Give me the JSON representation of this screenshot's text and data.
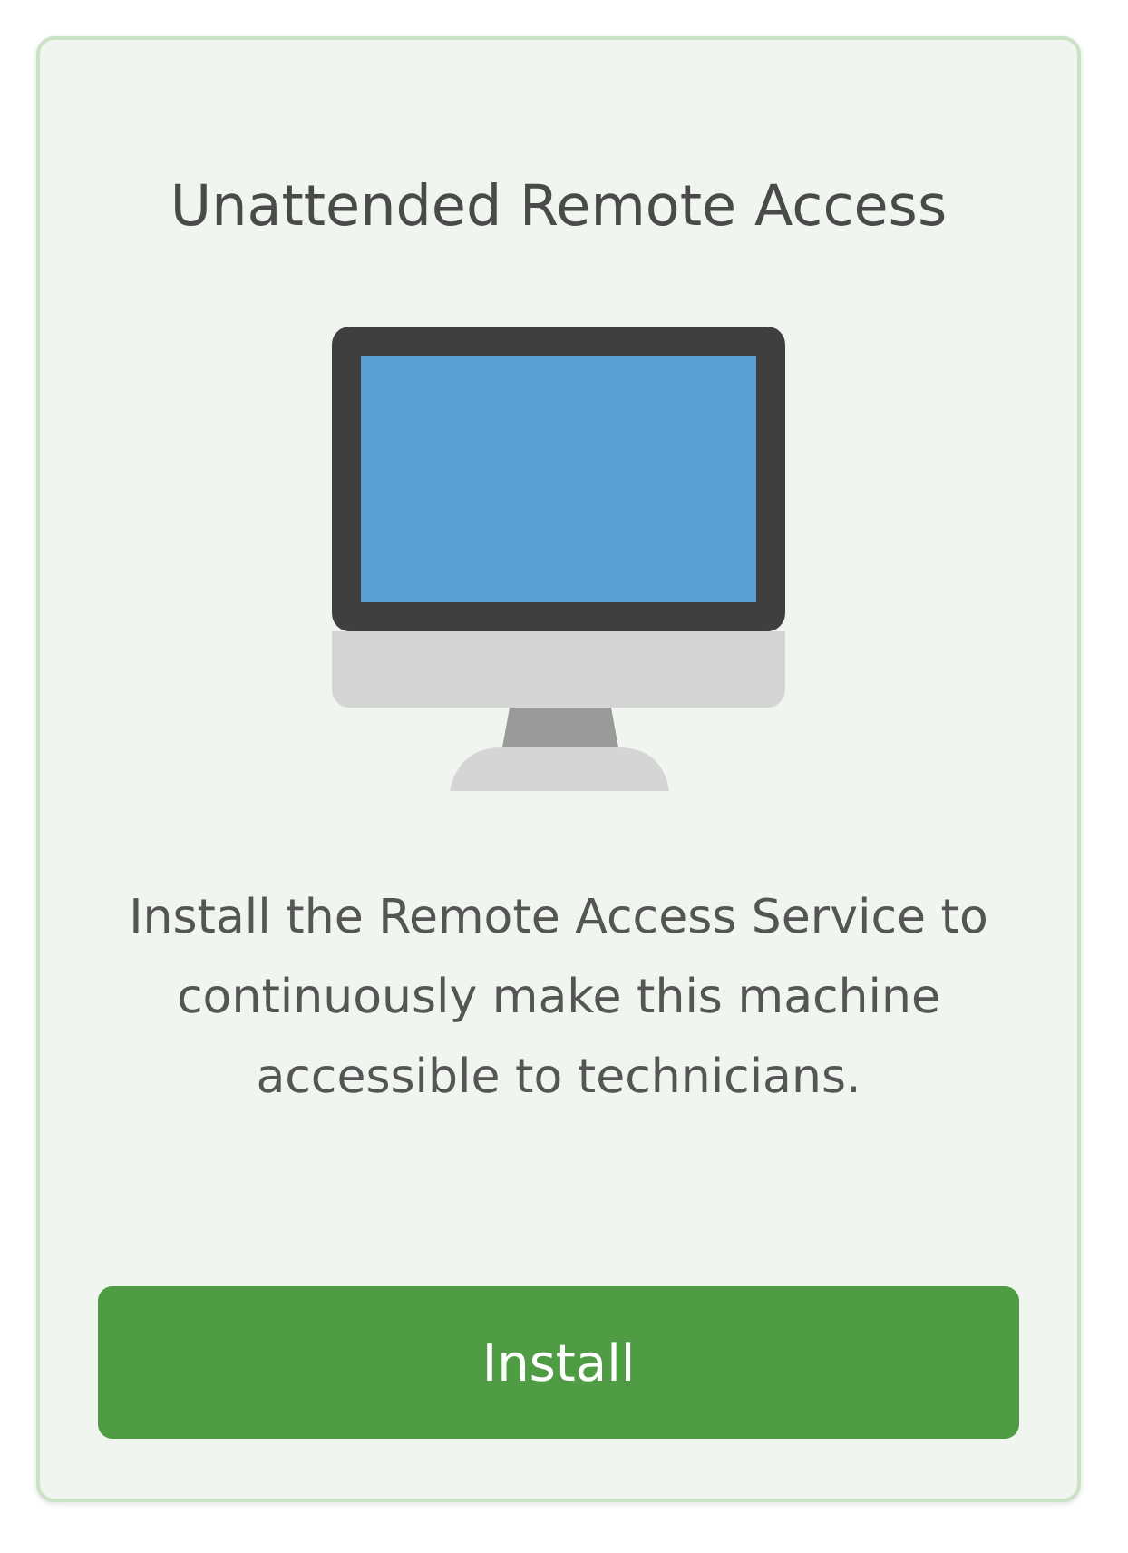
{
  "card": {
    "title": "Unattended Remote Access",
    "description": "Install the Remote Access Service to continuously make this machine accessible to technicians.",
    "button": {
      "label": "Install"
    }
  }
}
